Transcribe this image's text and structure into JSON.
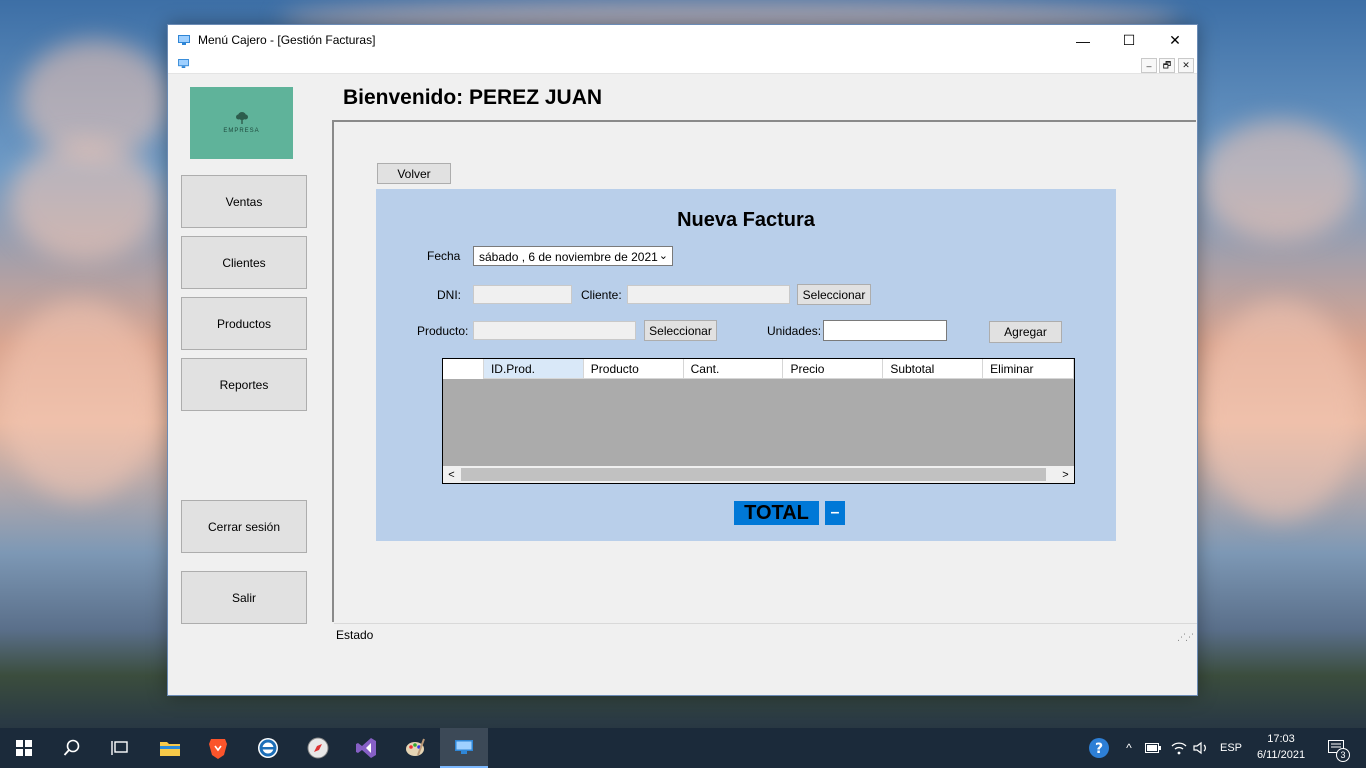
{
  "window": {
    "title": "Menú Cajero - [Gestión Facturas]",
    "minimize_glyph": "—",
    "maximize_glyph": "☐",
    "close_glyph": "✕",
    "mdi_minimize": "–",
    "mdi_restore": "🗗",
    "mdi_close": "✕"
  },
  "logo": {
    "text": "EMPRESA",
    "color": "#5fb39a"
  },
  "sidebar": {
    "items": [
      {
        "label": "Ventas"
      },
      {
        "label": "Clientes"
      },
      {
        "label": "Productos"
      },
      {
        "label": "Reportes"
      },
      {
        "label": "Cerrar sesión"
      },
      {
        "label": "Salir"
      }
    ]
  },
  "header": {
    "welcome": "Bienvenido: PEREZ JUAN"
  },
  "main": {
    "back_button": "Volver",
    "form": {
      "title": "Nueva Factura",
      "fecha_label": "Fecha",
      "fecha_value": "sábado   ,    6 de noviembre de 2021",
      "dni_label": "DNI:",
      "dni_value": "",
      "cliente_label": "Cliente:",
      "cliente_value": "",
      "select_client_button": "Seleccionar",
      "producto_label": "Producto:",
      "producto_value": "",
      "select_product_button": "Seleccionar",
      "unidades_label": "Unidades:",
      "unidades_value": "",
      "add_button": "Agregar",
      "panel_color": "#b9cfea"
    },
    "grid": {
      "columns": [
        "ID.Prod.",
        "Producto",
        "Cant.",
        "Precio",
        "Subtotal",
        "Eliminar"
      ],
      "rows": [],
      "scroll_left": "<",
      "scroll_right": ">"
    },
    "total": {
      "label": "TOTAL",
      "value": "–",
      "color": "#0078d7"
    }
  },
  "status_bar": {
    "text": "Estado"
  },
  "taskbar": {
    "icons": [
      "windows-start-icon",
      "search-icon",
      "task-view-icon",
      "file-explorer-icon",
      "brave-browser-icon",
      "edge-icon",
      "compass-icon",
      "visual-studio-icon",
      "paint-icon",
      "app-window-icon"
    ],
    "language": "ESP",
    "time": "17:03",
    "date": "6/11/2021",
    "notification_count": "3"
  }
}
